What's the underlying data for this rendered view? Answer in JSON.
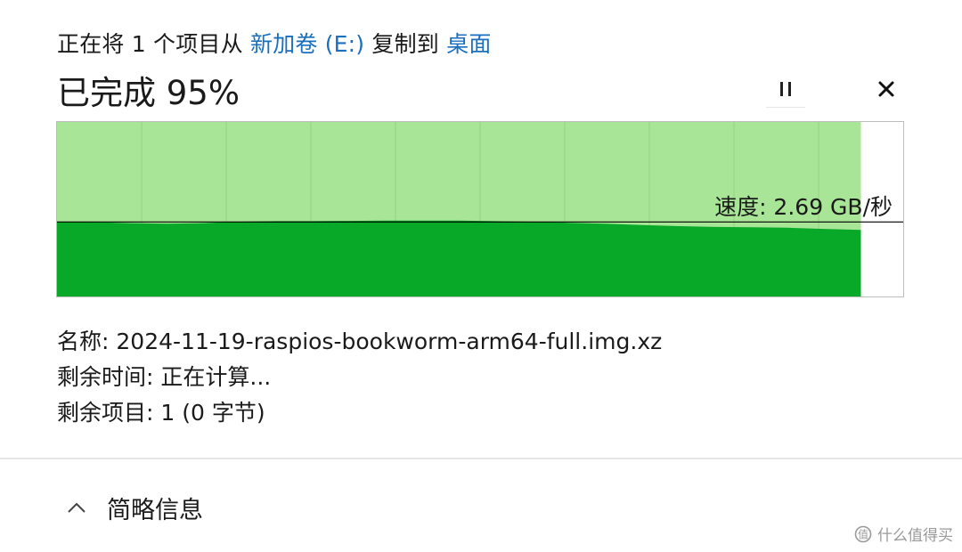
{
  "header": {
    "prefix": "正在将 1 个项目从 ",
    "source": "新加卷 (E:)",
    "middle": " 复制到 ",
    "destination": "桌面"
  },
  "progress": {
    "title": "已完成 95%",
    "percent": 95
  },
  "controls": {
    "pause_icon": "pause-icon",
    "close_icon": "close-icon"
  },
  "graph": {
    "speed_text": "速度: 2.69 GB/秒",
    "speed_value_gb_per_s": 2.69,
    "max_speed_gb_per_s": 6.3,
    "completed_fraction": 0.95,
    "speed_history": [
      2.7,
      2.68,
      2.65,
      2.63,
      2.65,
      2.7,
      2.72,
      2.72,
      2.73,
      2.74,
      2.74,
      2.74,
      2.72,
      2.7,
      2.66,
      2.63,
      2.58,
      2.54,
      2.51,
      2.5,
      2.48,
      2.44,
      2.4
    ],
    "colors": {
      "completed_fill": "#a8e596",
      "speed_fill": "#08a829",
      "speed_line": "#000000",
      "grid": "#93d481"
    }
  },
  "details": {
    "name_label": "名称:",
    "name_value": "2024-11-19-raspios-bookworm-arm64-full.img.xz",
    "time_label": "剩余时间:",
    "time_value": "正在计算...",
    "items_label": "剩余项目:",
    "items_value": "1 (0 字节)"
  },
  "footer": {
    "toggle_label": "简略信息",
    "toggle_icon": "chevron-up-icon"
  },
  "watermark": {
    "text": "什么值得买"
  }
}
